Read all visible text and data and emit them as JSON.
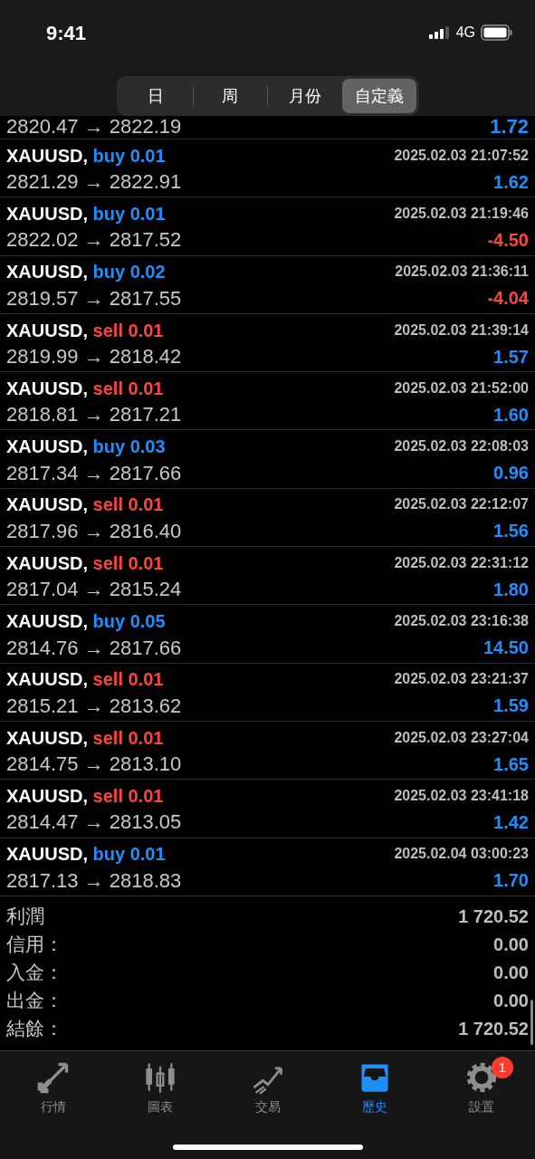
{
  "status_bar": {
    "time": "9:41",
    "network": "4G"
  },
  "period_tabs": [
    {
      "label": "日",
      "selected": false
    },
    {
      "label": "周",
      "selected": false
    },
    {
      "label": "月份",
      "selected": false
    },
    {
      "label": "自定義",
      "selected": true
    }
  ],
  "partial_row": {
    "prices": "2820.47 → 2822.19",
    "profit": "1.72",
    "loss": false
  },
  "trades": [
    {
      "symbol": "XAUUSD,",
      "side": "buy",
      "volume": "0.01",
      "kind": "buy",
      "time": "2025.02.03 21:07:52",
      "prices": "2821.29 → 2822.91",
      "profit": "1.62",
      "loss": false
    },
    {
      "symbol": "XAUUSD,",
      "side": "buy",
      "volume": "0.01",
      "kind": "buy",
      "time": "2025.02.03 21:19:46",
      "prices": "2822.02 → 2817.52",
      "profit": "-4.50",
      "loss": true
    },
    {
      "symbol": "XAUUSD,",
      "side": "buy",
      "volume": "0.02",
      "kind": "buy",
      "time": "2025.02.03 21:36:11",
      "prices": "2819.57 → 2817.55",
      "profit": "-4.04",
      "loss": true
    },
    {
      "symbol": "XAUUSD,",
      "side": "sell",
      "volume": "0.01",
      "kind": "sell",
      "time": "2025.02.03 21:39:14",
      "prices": "2819.99 → 2818.42",
      "profit": "1.57",
      "loss": false
    },
    {
      "symbol": "XAUUSD,",
      "side": "sell",
      "volume": "0.01",
      "kind": "sell",
      "time": "2025.02.03 21:52:00",
      "prices": "2818.81 → 2817.21",
      "profit": "1.60",
      "loss": false
    },
    {
      "symbol": "XAUUSD,",
      "side": "buy",
      "volume": "0.03",
      "kind": "buy",
      "time": "2025.02.03 22:08:03",
      "prices": "2817.34 → 2817.66",
      "profit": "0.96",
      "loss": false
    },
    {
      "symbol": "XAUUSD,",
      "side": "sell",
      "volume": "0.01",
      "kind": "sell",
      "time": "2025.02.03 22:12:07",
      "prices": "2817.96 → 2816.40",
      "profit": "1.56",
      "loss": false
    },
    {
      "symbol": "XAUUSD,",
      "side": "sell",
      "volume": "0.01",
      "kind": "sell",
      "time": "2025.02.03 22:31:12",
      "prices": "2817.04 → 2815.24",
      "profit": "1.80",
      "loss": false
    },
    {
      "symbol": "XAUUSD,",
      "side": "buy",
      "volume": "0.05",
      "kind": "buy",
      "time": "2025.02.03 23:16:38",
      "prices": "2814.76 → 2817.66",
      "profit": "14.50",
      "loss": false
    },
    {
      "symbol": "XAUUSD,",
      "side": "sell",
      "volume": "0.01",
      "kind": "sell",
      "time": "2025.02.03 23:21:37",
      "prices": "2815.21 → 2813.62",
      "profit": "1.59",
      "loss": false
    },
    {
      "symbol": "XAUUSD,",
      "side": "sell",
      "volume": "0.01",
      "kind": "sell",
      "time": "2025.02.03 23:27:04",
      "prices": "2814.75 → 2813.10",
      "profit": "1.65",
      "loss": false
    },
    {
      "symbol": "XAUUSD,",
      "side": "sell",
      "volume": "0.01",
      "kind": "sell",
      "time": "2025.02.03 23:41:18",
      "prices": "2814.47 → 2813.05",
      "profit": "1.42",
      "loss": false
    },
    {
      "symbol": "XAUUSD,",
      "side": "buy",
      "volume": "0.01",
      "kind": "buy",
      "time": "2025.02.04 03:00:23",
      "prices": "2817.13 → 2818.83",
      "profit": "1.70",
      "loss": false
    }
  ],
  "summary": [
    {
      "label": "利潤",
      "value": "1 720.52"
    },
    {
      "label": "信用：",
      "value": "0.00"
    },
    {
      "label": "入金：",
      "value": "0.00"
    },
    {
      "label": "出金：",
      "value": "0.00"
    },
    {
      "label": "結餘：",
      "value": "1 720.52"
    }
  ],
  "tab_bar": [
    {
      "label": "行情",
      "kind": "quotes",
      "selected": false
    },
    {
      "label": "圖表",
      "kind": "chart",
      "selected": false
    },
    {
      "label": "交易",
      "kind": "trade",
      "selected": false
    },
    {
      "label": "歷史",
      "kind": "history",
      "selected": true
    },
    {
      "label": "設置",
      "kind": "settings",
      "selected": false,
      "badge": "1"
    }
  ]
}
